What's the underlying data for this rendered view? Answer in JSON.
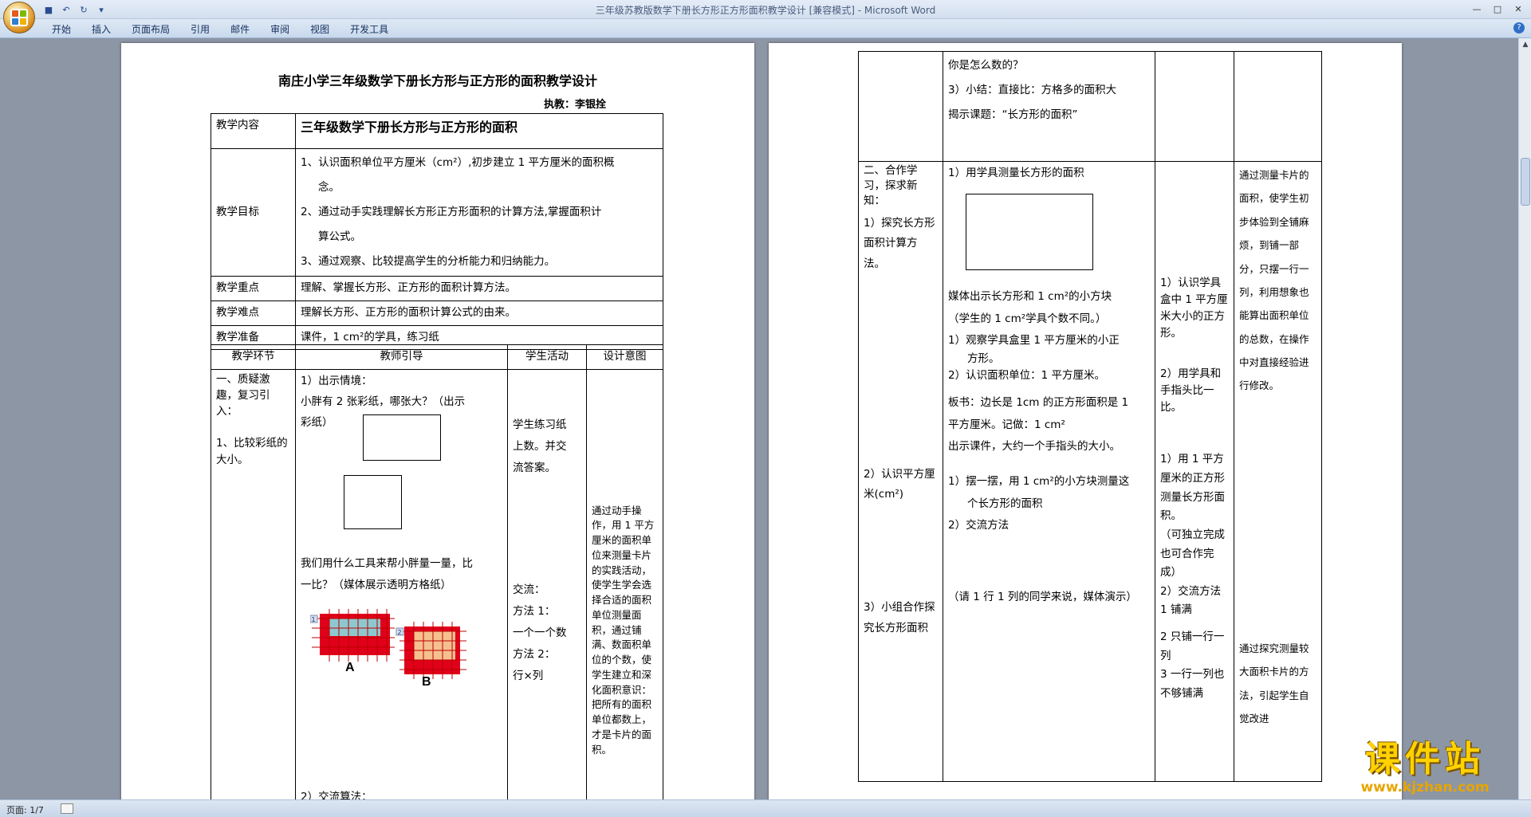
{
  "window": {
    "title": "三年级苏教版数学下册长方形正方形面积教学设计 [兼容模式] - Microsoft Word"
  },
  "ribbon": {
    "tabs": [
      "开始",
      "插入",
      "页面布局",
      "引用",
      "邮件",
      "审阅",
      "视图",
      "开发工具"
    ]
  },
  "status": {
    "page": "页面: 1/7"
  },
  "doc": {
    "title": "南庄小学三年级数学下册长方形与正方形的面积教学设计",
    "author": "执教：李银拴",
    "content_label": "教学内容",
    "content_value": "三年级数学下册长方形与正方形的面积",
    "goals_label": "教学目标",
    "goal1": "1、认识面积单位平方厘米（cm²）,初步建立 1 平方厘米的面积概",
    "goal1b": "念。",
    "goal2": "2、通过动手实践理解长方形正方形面积的计算方法,掌握面积计",
    "goal2b": "算公式。",
    "goal3": "3、通过观察、比较提高学生的分析能力和归纳能力。",
    "key_label": "教学重点",
    "key_value": "理解、掌握长方形、正方形的面积计算方法。",
    "diff_label": "教学难点",
    "diff_value": "理解长方形、正方形的面积计算公式的由来。",
    "prep_label": "教学准备",
    "prep_value": "课件，1 cm²的学具，练习纸",
    "headers": [
      "教学环节",
      "教师引导",
      "学生活动",
      "设计意图"
    ],
    "left_stage1": "一、质疑激趣，复习引入：",
    "left_stage1b": "1、比较彩纸的大小。",
    "teacher1": "1）出示情境：",
    "teacher1b": "小胖有 2 张彩纸，哪张大？（出示",
    "teacher1c": "彩纸）",
    "teacher2": "我们用什么工具来帮小胖量一量，比",
    "teacher2b": "一比？（媒体展示透明方格纸）",
    "teacher3": "2）交流算法：",
    "student1": "学生练习纸",
    "student1b": "上数。并交",
    "student1c": "流答案。",
    "student2": "交流：",
    "student2b": "方法 1：",
    "student2c": "一个一个数",
    "student2d": "方法 2：",
    "student2e": "行×列",
    "intent1": "通过动手操作，用 1 平方厘米的面积单位来测量卡片的实践活动，使学生学会选择合适的面积单位测量面积，通过铺满、数面积单位的个数，使学生建立和深化面积意识：把所有的面积单位都数上，才是卡片的面积。",
    "fig_a": "A",
    "fig_b": "B",
    "fig_n1": "1",
    "fig_n2": "2"
  },
  "doc2": {
    "t1": "你是怎么数的？",
    "t2": "3）小结：直接比：方格多的面积大",
    "t3": "揭示课题：“长方形的面积”",
    "stage2": "二、合作学习，探求新知：",
    "stage2a": "1）探究长方形面积计算方法。",
    "stage2b": "2）认识平方厘米(cm²)",
    "stage2c": "3）小组合作探究长方形面积",
    "m1": "1）用学具测量长方形的面积",
    "m2": "媒体出示长方形和 1 cm²的小方块",
    "m3": "（学生的 1 cm²学具个数不同。）",
    "m4": "1）观察学具盒里 1 平方厘米的小正",
    "m4b": "方形。",
    "m5": "2）认识面积单位：1 平方厘米。",
    "m6": "板书：边长是 1cm 的正方形面积是 1",
    "m6b": "平方厘米。记做：1 cm²",
    "m7": "出示课件，大约一个手指头的大小。",
    "m8": "1）摆一摆，用 1 cm²的小方块测量这",
    "m8b": "个长方形的面积",
    "m9": "2）交流方法",
    "m10": "（请 1 行 1 列的同学来说，媒体演示）",
    "s1": "1）认识学具盒中 1 平方厘米大小的正方形。",
    "s2": "2）用学具和手指头比一比。",
    "s3": "1）用 1 平方厘米的正方形测量长方形面积。",
    "s4": "（可独立完成也可合作完成）",
    "s5": "2）交流方法",
    "s6": "1 铺满",
    "s7": "2 只铺一行一列",
    "s8": "3 一行一列也不够铺满",
    "i1": "通过测量卡片的面积，使学生初步体验到全铺麻烦，到铺一部分，只摆一行一列，利用想象也能算出面积单位的总数，在操作中对直接经验进行修改。",
    "i2": "通过探究测量较大面积卡片的方法，引起学生自觉改进"
  },
  "watermark": {
    "text": "课件站",
    "url": "www.kjzhan.com"
  }
}
